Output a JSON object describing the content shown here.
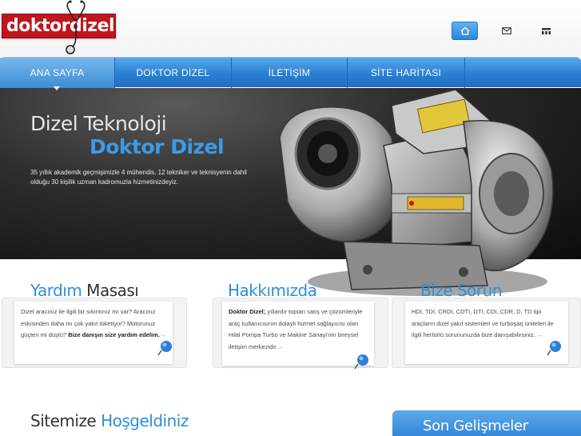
{
  "header": {
    "logo_text": "doktordizel",
    "icons": [
      {
        "name": "home-icon"
      },
      {
        "name": "mail-icon"
      },
      {
        "name": "sitemap-icon"
      }
    ]
  },
  "nav": {
    "items": [
      {
        "label": "ANA SAYFA",
        "active": true
      },
      {
        "label": "DOKTOR DİZEL",
        "active": false
      },
      {
        "label": "İLETİŞİM",
        "active": false
      },
      {
        "label": "SİTE HARİTASI",
        "active": false
      }
    ]
  },
  "banner": {
    "title_line1": "Dizel Teknoloji",
    "title_line2": "Doktor Dizel",
    "description": "35 yıllık akademik geçmişimizle 4 mühendis, 12 tekniker ve teknisyenin dahil olduğu 30 kişilik uzman kadromuzla hizmetinizdeyiz."
  },
  "columns": [
    {
      "title_part1": "Yardım",
      "title_part2": " Masası",
      "text": "Dizel aracınız ile ilgili bir sıkıntınız mı var? Aracınız eskisinden daha mı çok yakıt tüketiyor? Motorunuz güçten mi düştü?",
      "bold_text": "Bize danışın size yardım edelim.",
      "more": "→"
    },
    {
      "title_part1": "Hakkımızda",
      "title_part2": "",
      "bold_lead": "Doktor Dizel;",
      "text": " yıllardır toptan satış ve çözümleriyle araç kullanıcısının dolaylı hizmet sağlayıcısı olan Hilal Pompa Turbo ve Makine Sanayi'nin bireysel iletişim merkezidir.",
      "more": "→"
    },
    {
      "title_part1": "Bize",
      "title_part2": " Sorun",
      "text": "HDI, TDI, CRDI, CDTI, DTI, CDI, CDR, D, TD tipi araçların dizel yakıt sistemleri ve turboşarj üniteleri ile ilgili hertürlü sorununuzda bize danışabilirsiniz..",
      "more": "→"
    }
  ],
  "welcome": {
    "part1": "Sitemize",
    "part2": " Hoşgeldiniz"
  },
  "latest": {
    "part1": "Son",
    "part2": " Gelişmeler"
  },
  "colors": {
    "brand_red": "#c0161c",
    "accent_blue": "#2f8ed9",
    "nav_blue": "#2a7fd2"
  }
}
